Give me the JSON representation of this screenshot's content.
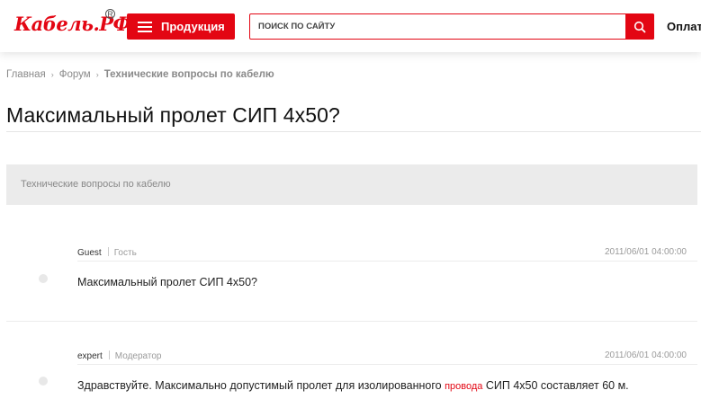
{
  "header": {
    "logo_text": "Кабель.РФ",
    "logo_reg": "R",
    "products_label": "Продукция",
    "search_placeholder": "ПОИСК ПО САЙТУ",
    "link_pay": "Оплат"
  },
  "breadcrumb": {
    "items": [
      "Главная",
      "Форум",
      "Технические вопросы по кабелю"
    ],
    "separator": "›"
  },
  "page_title": "Максимальный пролет СИП 4x50?",
  "category": "Технические вопросы по кабелю",
  "posts": [
    {
      "author": "Guest",
      "role": "Гость",
      "date": "2011/06/01 04:00:00",
      "text": "Максимальный пролет СИП 4x50?"
    },
    {
      "author": "expert",
      "role": "Модератор",
      "date": "2011/06/01 04:00:00",
      "text_before": "Здравствуйте. Максимально допустимый пролет для изолированного ",
      "link": "провода",
      "text_after": " СИП 4x50 составляет 60 м."
    }
  ],
  "colors": {
    "brand_red": "#e30613",
    "category_bg": "#ebebeb"
  },
  "icons": [
    "menu-icon",
    "search-icon",
    "registered-mark"
  ]
}
